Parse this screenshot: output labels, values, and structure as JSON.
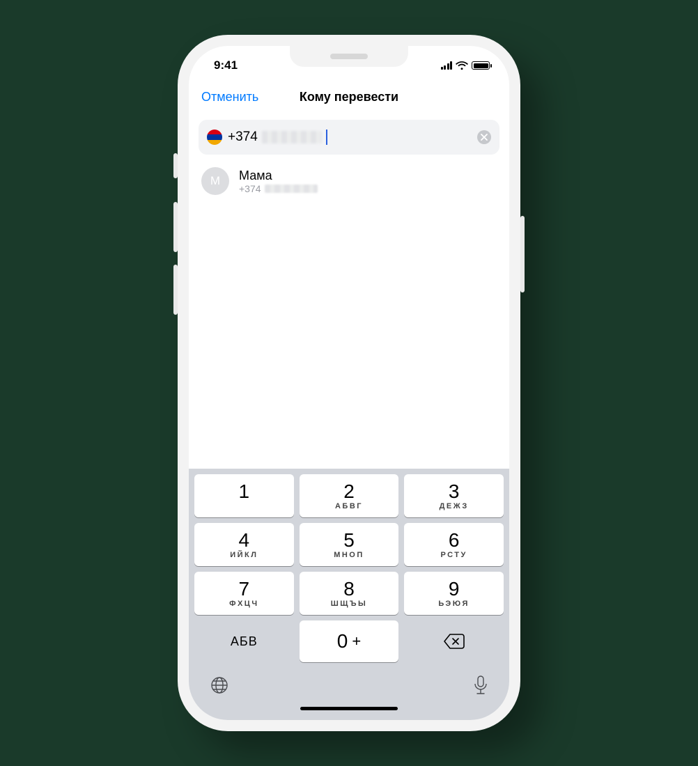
{
  "status": {
    "time": "9:41"
  },
  "nav": {
    "cancel": "Отменить",
    "title": "Кому перевести"
  },
  "phone_field": {
    "dial_code": "+374",
    "flag": {
      "top": "#d90012",
      "mid": "#0033a0",
      "bot": "#f2a800"
    }
  },
  "contact": {
    "initial": "М",
    "name": "Мама",
    "prefix": "+374"
  },
  "keyboard": {
    "switch_label": "АБВ",
    "keys": [
      {
        "digit": "1",
        "letters": ""
      },
      {
        "digit": "2",
        "letters": "АБВГ"
      },
      {
        "digit": "3",
        "letters": "ДЕЖЗ"
      },
      {
        "digit": "4",
        "letters": "ИЙКЛ"
      },
      {
        "digit": "5",
        "letters": "МНОП"
      },
      {
        "digit": "6",
        "letters": "РСТУ"
      },
      {
        "digit": "7",
        "letters": "ФХЦЧ"
      },
      {
        "digit": "8",
        "letters": "ШЩЪЫ"
      },
      {
        "digit": "9",
        "letters": "ЬЭЮЯ"
      }
    ],
    "zero": {
      "digit": "0",
      "plus": "+"
    }
  }
}
